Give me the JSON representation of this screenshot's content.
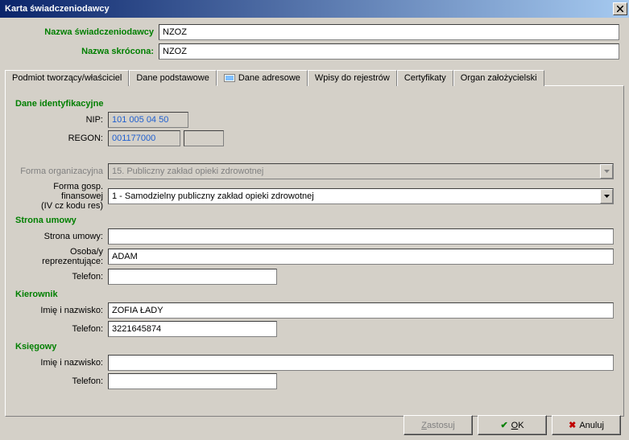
{
  "window": {
    "title": "Karta świadczeniodawcy"
  },
  "header": {
    "nameLabel": "Nazwa świadczeniodawcy",
    "nameValue": "NZOZ",
    "shortLabel": "Nazwa skrócona:",
    "shortValue": "NZOZ"
  },
  "tabs": {
    "t1": "Podmiot tworzący/właściciel",
    "t2": "Dane podstawowe",
    "t3": "Dane adresowe",
    "t4": "Wpisy do rejestrów",
    "t5": "Certyfikaty",
    "t6": "Organ założycielski"
  },
  "ident": {
    "section": "Dane identyfikacyjne",
    "nipLabel": "NIP:",
    "nipValue": "101 005 04 50",
    "regonLabel": "REGON:",
    "regonValue": "001177000",
    "regon2": ""
  },
  "org": {
    "formaOrgLabel": "Forma organizacyjna",
    "formaOrgValue": "15. Publiczny zakład opieki zdrowotnej",
    "formaGospLabel1": "Forma gosp. finansowej",
    "formaGospLabel2": "(IV cz kodu res)",
    "formaGospValue": "1 - Samodzielny publiczny zakład opieki zdrowotnej"
  },
  "umowa": {
    "section": "Strona umowy",
    "stronaLabel": "Strona umowy:",
    "stronaValue": "",
    "osobaLabel": "Osoba/y reprezentujące:",
    "osobaValue": "ADAM",
    "telLabel": "Telefon:",
    "telValue": ""
  },
  "kierownik": {
    "section": "Kierownik",
    "imieLabel": "Imię i nazwisko:",
    "imieValue": "ZOFIA ŁADY",
    "telLabel": "Telefon:",
    "telValue": "3221645874"
  },
  "ksiegowy": {
    "section": "Księgowy",
    "imieLabel": "Imię i nazwisko:",
    "imieValue": "",
    "telLabel": "Telefon:",
    "telValue": ""
  },
  "buttons": {
    "zastosuj": "Zastosuj",
    "ok": "OK",
    "anuluj": "Anuluj"
  }
}
